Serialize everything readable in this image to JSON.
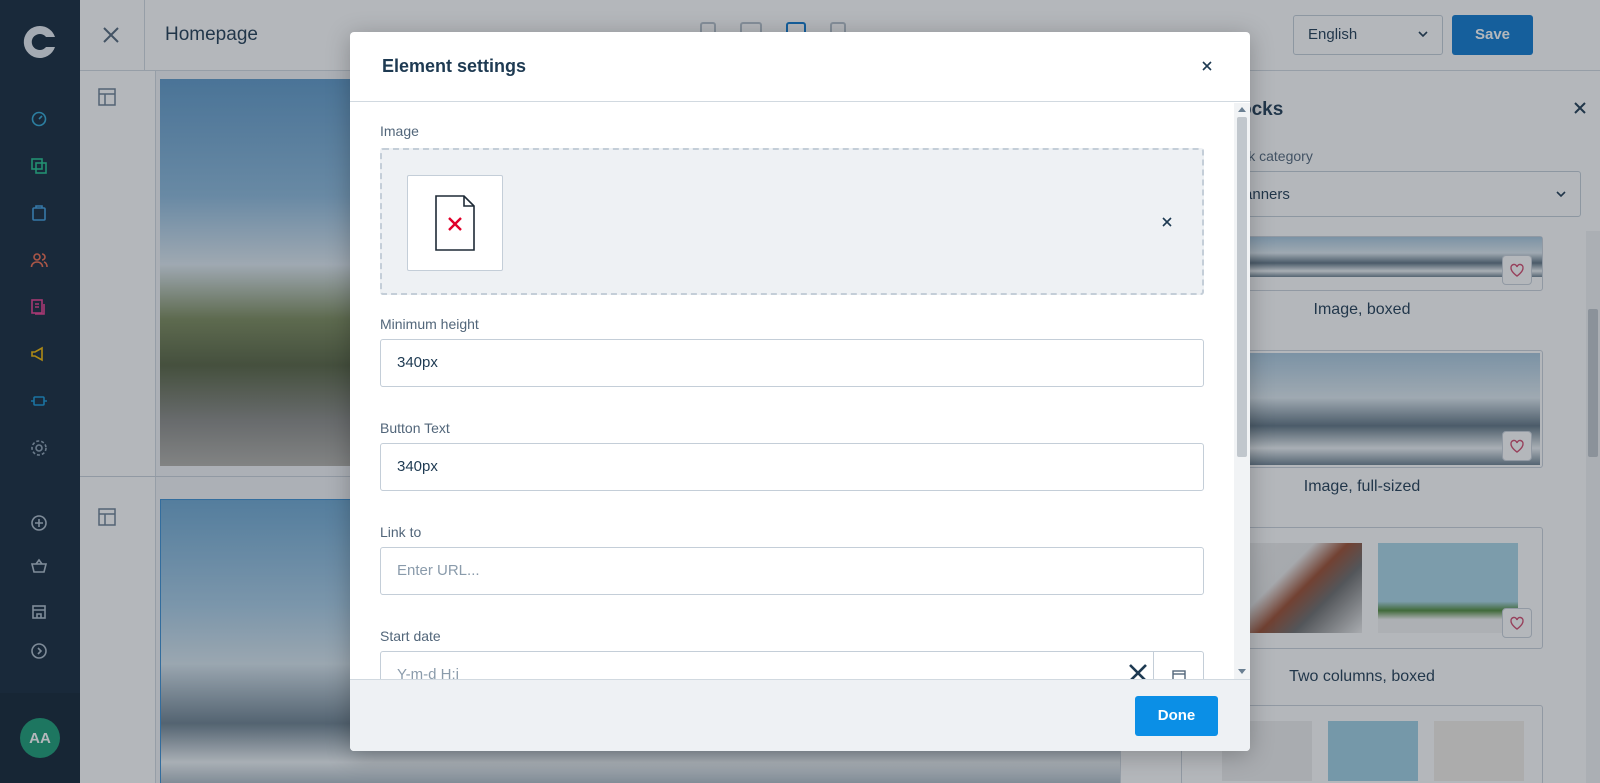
{
  "app": {
    "page_title": "Homepage",
    "language": "English",
    "save_label": "Save",
    "avatar_initials": "AA"
  },
  "panel": {
    "title": "Blocks",
    "category_label": "Block category",
    "category_value": "Banners",
    "blocks": [
      {
        "label": "Image, boxed"
      },
      {
        "label": "Image, full-sized"
      },
      {
        "label": "Two columns, boxed"
      }
    ]
  },
  "modal": {
    "title": "Element settings",
    "fields": {
      "image_label": "Image",
      "min_height_label": "Minimum height",
      "min_height_value": "340px",
      "button_text_label": "Button Text",
      "button_text_value": "340px",
      "link_label": "Link to",
      "link_placeholder": "Enter URL...",
      "start_date_label": "Start date",
      "start_date_placeholder": "Y-m-d H:i"
    },
    "done_label": "Done"
  },
  "colors": {
    "nav_bg": "#12263a",
    "primary": "#0b79d0",
    "done": "#0b8fe6",
    "error_icon": "#e0002a",
    "heart": "#d34a6d"
  }
}
